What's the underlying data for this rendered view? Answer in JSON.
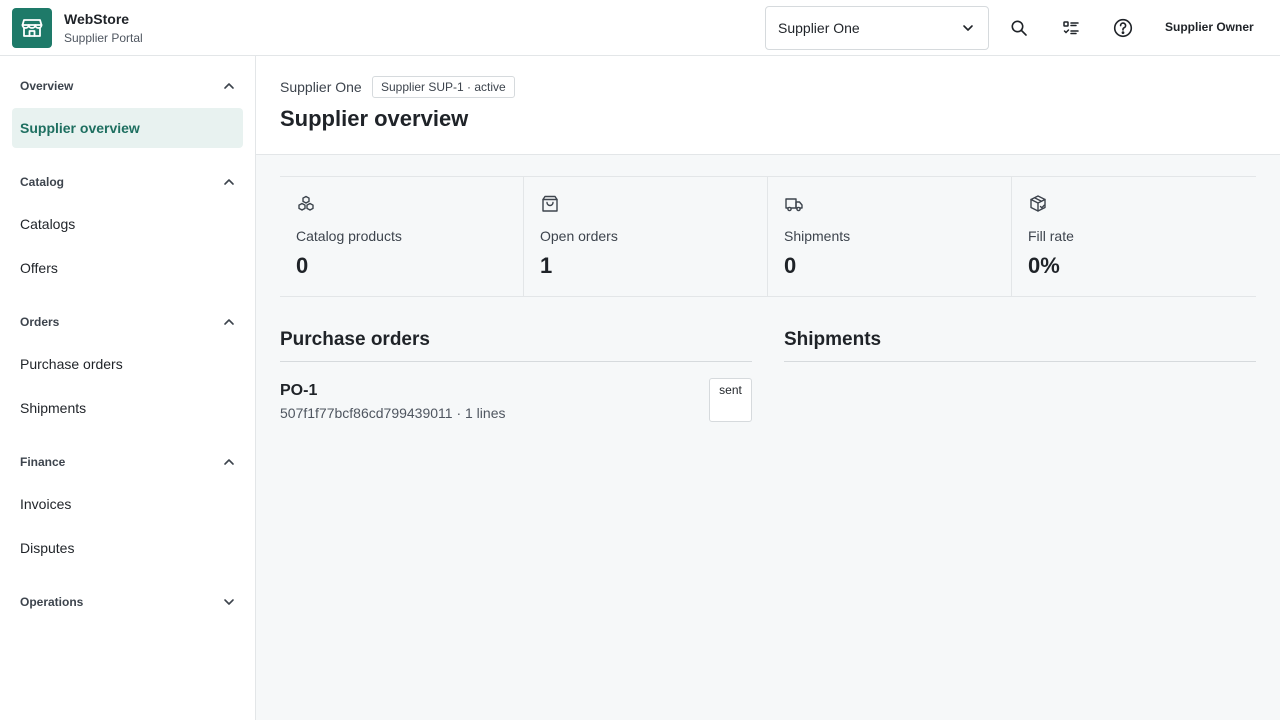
{
  "header": {
    "brand_name": "WebStore",
    "brand_sub": "Supplier Portal",
    "supplier_select": "Supplier One",
    "user_name": "Supplier Owner",
    "accent": "#1e7a69"
  },
  "sidebar": {
    "sections": [
      {
        "label": "Overview",
        "expanded": true,
        "items": [
          {
            "label": "Supplier overview",
            "active": true
          }
        ]
      },
      {
        "label": "Catalog",
        "expanded": true,
        "items": [
          {
            "label": "Catalogs"
          },
          {
            "label": "Offers"
          }
        ]
      },
      {
        "label": "Orders",
        "expanded": true,
        "items": [
          {
            "label": "Purchase orders"
          },
          {
            "label": "Shipments"
          }
        ]
      },
      {
        "label": "Finance",
        "expanded": true,
        "items": [
          {
            "label": "Invoices"
          },
          {
            "label": "Disputes"
          }
        ]
      },
      {
        "label": "Operations",
        "expanded": false,
        "items": []
      }
    ]
  },
  "main": {
    "breadcrumb": "Supplier One",
    "chip": "Supplier SUP-1 · active",
    "title": "Supplier overview",
    "stats": [
      {
        "label": "Catalog products",
        "value": "0",
        "icon": "boxes-icon"
      },
      {
        "label": "Open orders",
        "value": "1",
        "icon": "shopping-bag-icon"
      },
      {
        "label": "Shipments",
        "value": "0",
        "icon": "truck-icon"
      },
      {
        "label": "Fill rate",
        "value": "0%",
        "icon": "package-check-icon"
      }
    ],
    "purchase_orders": {
      "title": "Purchase orders",
      "rows": [
        {
          "id": "PO-1",
          "meta": "507f1f77bcf86cd799439011 · 1 lines",
          "status": "sent"
        }
      ]
    },
    "shipments": {
      "title": "Shipments"
    }
  }
}
